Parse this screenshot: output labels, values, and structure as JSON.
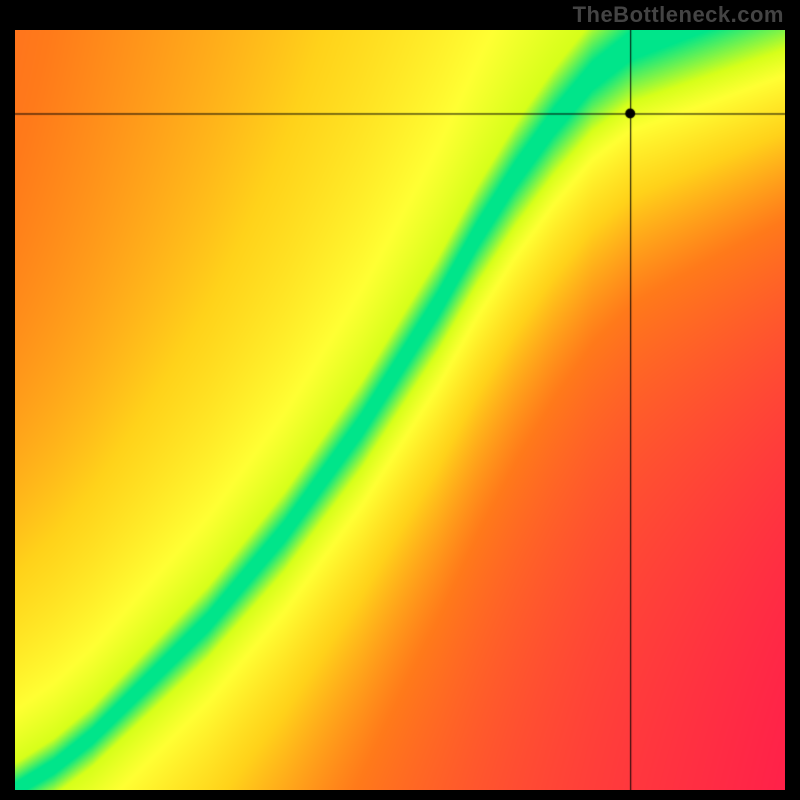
{
  "watermark": "TheBottleneck.com",
  "chart_data": {
    "type": "heatmap",
    "title": "",
    "xlabel": "",
    "ylabel": "",
    "xlim": [
      0,
      1
    ],
    "ylim": [
      0,
      1
    ],
    "grid": false,
    "legend": false,
    "colormap": {
      "stops": [
        {
          "t": 0.0,
          "color": "#ff1a4d"
        },
        {
          "t": 0.4,
          "color": "#ff7a1a"
        },
        {
          "t": 0.6,
          "color": "#ffd21a"
        },
        {
          "t": 0.78,
          "color": "#ffff33"
        },
        {
          "t": 0.88,
          "color": "#d6ff1a"
        },
        {
          "t": 0.97,
          "color": "#00e58a"
        }
      ]
    },
    "ideal_curve": {
      "description": "GPU-vs-CPU balance ridge (y as a function of x, normalized 0..1, origin lower-left)",
      "points": [
        {
          "x": 0.0,
          "y": 0.0
        },
        {
          "x": 0.05,
          "y": 0.03
        },
        {
          "x": 0.1,
          "y": 0.07
        },
        {
          "x": 0.15,
          "y": 0.12
        },
        {
          "x": 0.2,
          "y": 0.17
        },
        {
          "x": 0.25,
          "y": 0.22
        },
        {
          "x": 0.3,
          "y": 0.28
        },
        {
          "x": 0.35,
          "y": 0.34
        },
        {
          "x": 0.4,
          "y": 0.41
        },
        {
          "x": 0.45,
          "y": 0.48
        },
        {
          "x": 0.5,
          "y": 0.56
        },
        {
          "x": 0.55,
          "y": 0.64
        },
        {
          "x": 0.6,
          "y": 0.73
        },
        {
          "x": 0.65,
          "y": 0.81
        },
        {
          "x": 0.7,
          "y": 0.88
        },
        {
          "x": 0.75,
          "y": 0.94
        },
        {
          "x": 0.8,
          "y": 0.98
        },
        {
          "x": 0.85,
          "y": 1.0
        }
      ]
    },
    "ridge_halfwidth_base": 0.035,
    "ridge_halfwidth_grow": 0.05,
    "asymmetry": {
      "below_low": 0.0,
      "below_high": 0.45,
      "above_low": 0.35,
      "above_high": 0.8
    },
    "marker": {
      "x": 0.8,
      "y": 0.89
    },
    "crosshair": true
  }
}
